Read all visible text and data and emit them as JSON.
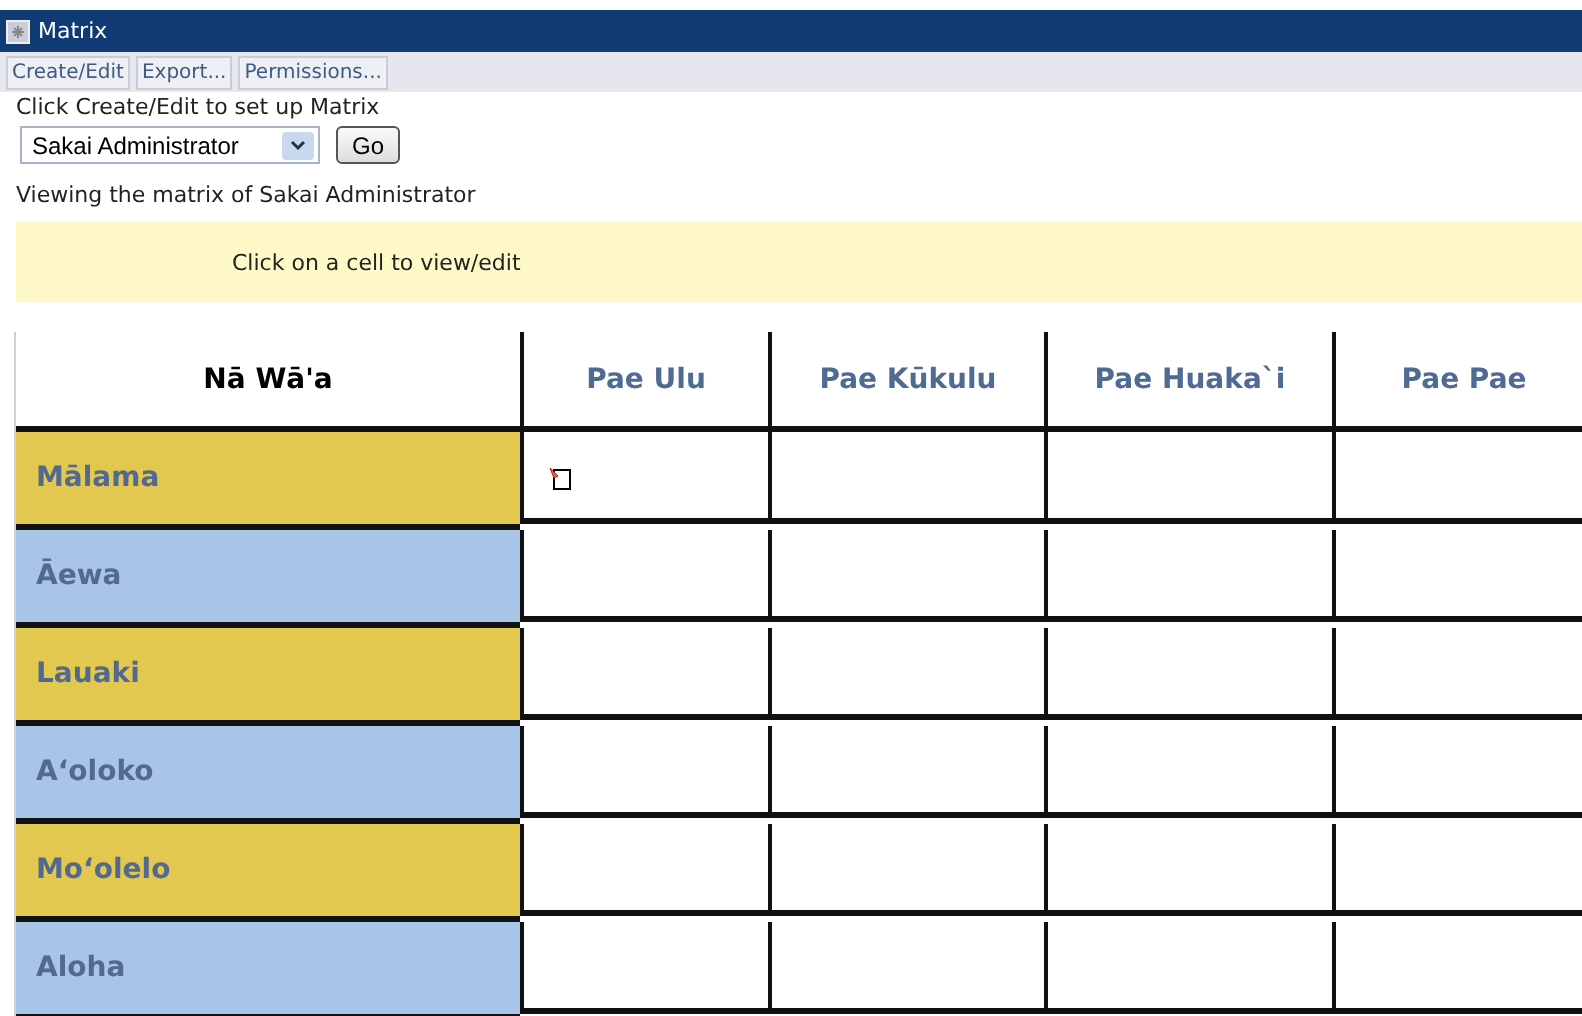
{
  "window": {
    "title": "Matrix"
  },
  "toolbar": [
    "Create/Edit",
    "Export...",
    "Permissions..."
  ],
  "instructions": "Click Create/Edit to set up Matrix",
  "user_select": {
    "value": "Sakai Administrator"
  },
  "go_button": "Go",
  "viewing": "Viewing the matrix of Sakai Administrator",
  "hint": "Click on a cell to view/edit",
  "matrix": {
    "corner": "Nā Wā'a",
    "columns": [
      "Pae Ulu",
      "Pae Kūkulu",
      "Pae Huaka`i",
      "Pae Pae"
    ],
    "rows": [
      {
        "label": "Mālama",
        "color": "#e3c84f",
        "cells": [
          {
            "filled": true
          },
          {
            "filled": false
          },
          {
            "filled": false
          },
          {
            "filled": false
          }
        ]
      },
      {
        "label": "Āewa",
        "color": "#a8c4e6",
        "cells": [
          {
            "filled": false
          },
          {
            "filled": false
          },
          {
            "filled": false
          },
          {
            "filled": false
          }
        ]
      },
      {
        "label": "Lauaki",
        "color": "#e3c84f",
        "cells": [
          {
            "filled": false
          },
          {
            "filled": false
          },
          {
            "filled": false
          },
          {
            "filled": false
          }
        ]
      },
      {
        "label": "A‘oloko",
        "color": "#a8c4e6",
        "cells": [
          {
            "filled": false
          },
          {
            "filled": false
          },
          {
            "filled": false
          },
          {
            "filled": false
          }
        ]
      },
      {
        "label": "Mo‘olelo",
        "color": "#e3c84f",
        "cells": [
          {
            "filled": false
          },
          {
            "filled": false
          },
          {
            "filled": false
          },
          {
            "filled": false
          }
        ]
      },
      {
        "label": "Aloha",
        "color": "#a8c4e6",
        "cells": [
          {
            "filled": false
          },
          {
            "filled": false
          },
          {
            "filled": false
          },
          {
            "filled": false
          }
        ]
      }
    ]
  }
}
